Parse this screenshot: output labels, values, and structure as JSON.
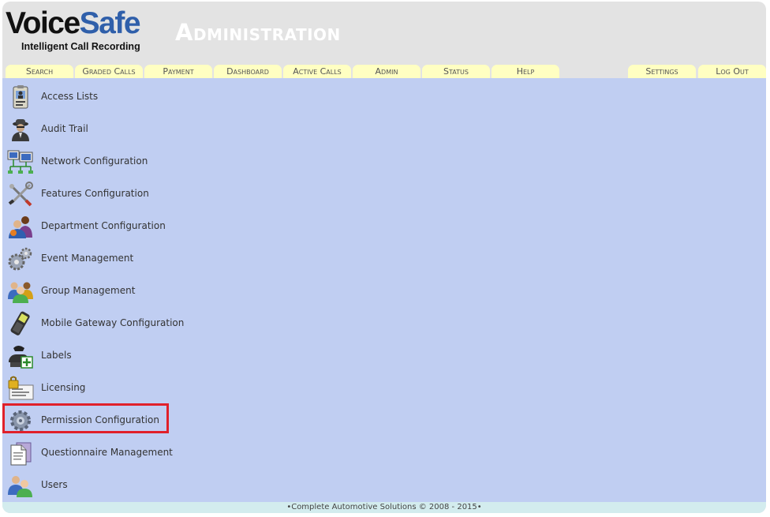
{
  "logo": {
    "word_voice": "Voice",
    "word_safe": "Safe",
    "tagline": "Intelligent Call Recording"
  },
  "page_title": "Administration",
  "tabs": [
    {
      "label": "Search"
    },
    {
      "label": "Graded Calls"
    },
    {
      "label": "Payment"
    },
    {
      "label": "Dashboard"
    },
    {
      "label": "Active Calls"
    },
    {
      "label": "Admin"
    },
    {
      "label": "Status"
    },
    {
      "label": "Help"
    },
    {
      "label": "Settings"
    },
    {
      "label": "Log Out"
    }
  ],
  "menu": [
    {
      "label": "Access Lists",
      "icon": "id-badge-icon"
    },
    {
      "label": "Audit Trail",
      "icon": "spy-icon"
    },
    {
      "label": "Network Configuration",
      "icon": "network-computers-icon"
    },
    {
      "label": "Features Configuration",
      "icon": "tools-icon"
    },
    {
      "label": "Department Configuration",
      "icon": "department-people-icon"
    },
    {
      "label": "Event Management",
      "icon": "gears-icon"
    },
    {
      "label": "Group Management",
      "icon": "group-people-icon"
    },
    {
      "label": "Mobile Gateway Configuration",
      "icon": "mobile-phone-icon"
    },
    {
      "label": "Labels",
      "icon": "phone-label-icon"
    },
    {
      "label": "Licensing",
      "icon": "license-certificate-icon"
    },
    {
      "label": "Permission Configuration",
      "icon": "permission-gear-icon"
    },
    {
      "label": "Questionnaire Management",
      "icon": "document-icon"
    },
    {
      "label": "Users",
      "icon": "users-icon"
    }
  ],
  "footer": "•Complete Automotive Solutions © 2008 - 2015•",
  "colors": {
    "content_bg": "#c0cef2",
    "tab_bg": "#ffffc2",
    "highlight": "#e0202a",
    "brand_blue": "#2f5faa"
  }
}
